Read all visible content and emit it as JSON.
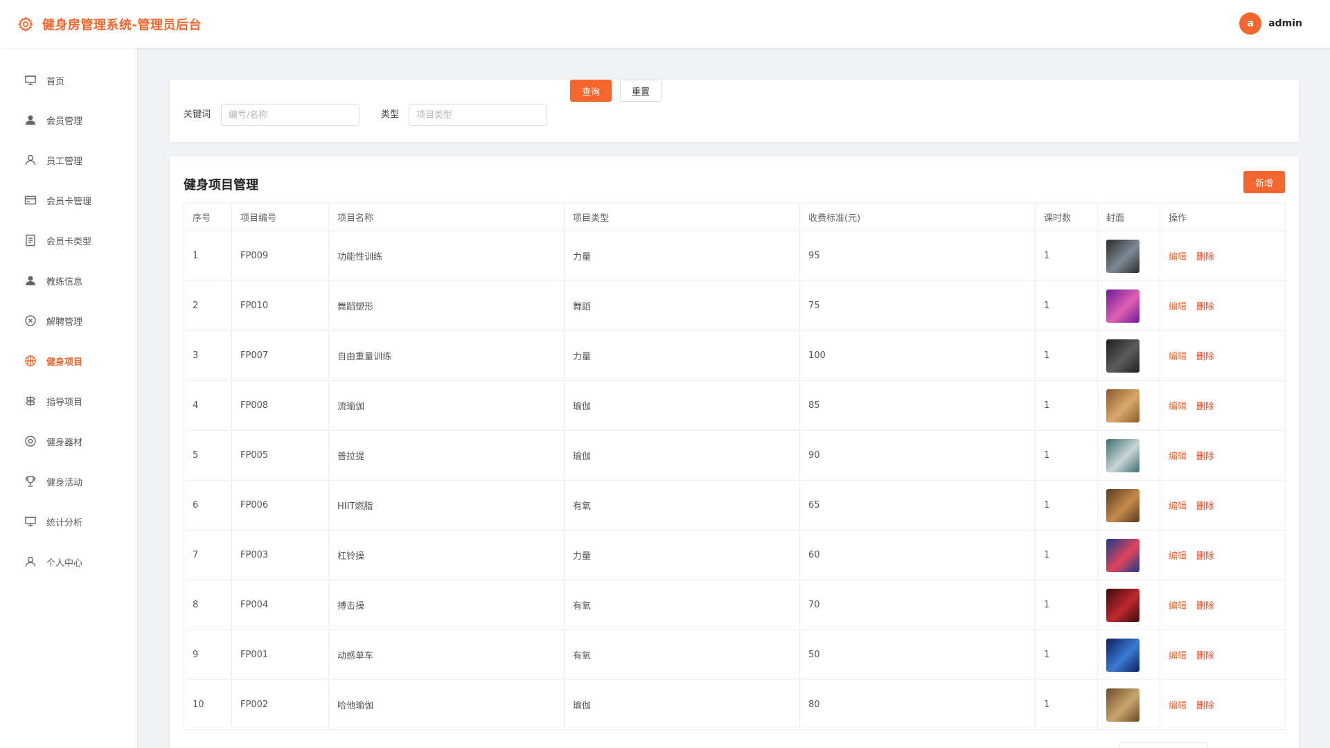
{
  "header": {
    "title": "健身房管理系统-管理员后台",
    "avatar_letter": "a",
    "username": "admin"
  },
  "sidebar": {
    "items": [
      {
        "label": "首页",
        "icon": "presentation-board-icon",
        "active": false
      },
      {
        "label": "会员管理",
        "icon": "user-filled-icon",
        "active": false
      },
      {
        "label": "员工管理",
        "icon": "user-outline-icon",
        "active": false
      },
      {
        "label": "会员卡管理",
        "icon": "credit-card-icon",
        "active": false
      },
      {
        "label": "会员卡类型",
        "icon": "document-icon",
        "active": false
      },
      {
        "label": "教练信息",
        "icon": "user-filled-icon",
        "active": false
      },
      {
        "label": "解聘管理",
        "icon": "circle-close-icon",
        "active": false
      },
      {
        "label": "健身项目",
        "icon": "basketball-icon",
        "active": true
      },
      {
        "label": "指导项目",
        "icon": "signpost-icon",
        "active": false
      },
      {
        "label": "健身器材",
        "icon": "football-icon",
        "active": false
      },
      {
        "label": "健身活动",
        "icon": "trophy-icon",
        "active": false
      },
      {
        "label": "统计分析",
        "icon": "presentation-board-icon",
        "active": false
      },
      {
        "label": "个人中心",
        "icon": "user-outline-icon",
        "active": false
      }
    ]
  },
  "search": {
    "keyword_label": "关键词",
    "keyword_placeholder": "编号/名称",
    "type_label": "类型",
    "type_placeholder": "项目类型",
    "query_button": "查询",
    "reset_button": "重置"
  },
  "table": {
    "title": "健身项目管理",
    "add_button": "新增",
    "columns": [
      "序号",
      "项目编号",
      "项目名称",
      "项目类型",
      "收费标准(元)",
      "课时数",
      "封面",
      "操作"
    ],
    "edit_label": "编辑",
    "delete_label": "删除",
    "rows": [
      {
        "index": "1",
        "code": "FP009",
        "name": "功能性训练",
        "type": "力量",
        "fee": "95",
        "hours": "1"
      },
      {
        "index": "2",
        "code": "FP010",
        "name": "舞蹈塑形",
        "type": "舞蹈",
        "fee": "75",
        "hours": "1"
      },
      {
        "index": "3",
        "code": "FP007",
        "name": "自由重量训练",
        "type": "力量",
        "fee": "100",
        "hours": "1"
      },
      {
        "index": "4",
        "code": "FP008",
        "name": "流瑜伽",
        "type": "瑜伽",
        "fee": "85",
        "hours": "1"
      },
      {
        "index": "5",
        "code": "FP005",
        "name": "普拉提",
        "type": "瑜伽",
        "fee": "90",
        "hours": "1"
      },
      {
        "index": "6",
        "code": "FP006",
        "name": "HIIT燃脂",
        "type": "有氧",
        "fee": "65",
        "hours": "1"
      },
      {
        "index": "7",
        "code": "FP003",
        "name": "杠铃操",
        "type": "力量",
        "fee": "60",
        "hours": "1"
      },
      {
        "index": "8",
        "code": "FP004",
        "name": "搏击操",
        "type": "有氧",
        "fee": "70",
        "hours": "1"
      },
      {
        "index": "9",
        "code": "FP001",
        "name": "动感单车",
        "type": "有氧",
        "fee": "50",
        "hours": "1"
      },
      {
        "index": "10",
        "code": "FP002",
        "name": "哈他瑜伽",
        "type": "瑜伽",
        "fee": "80",
        "hours": "1"
      }
    ]
  },
  "colors": {
    "accent": "#f4662d",
    "delete": "#e84a2e"
  }
}
